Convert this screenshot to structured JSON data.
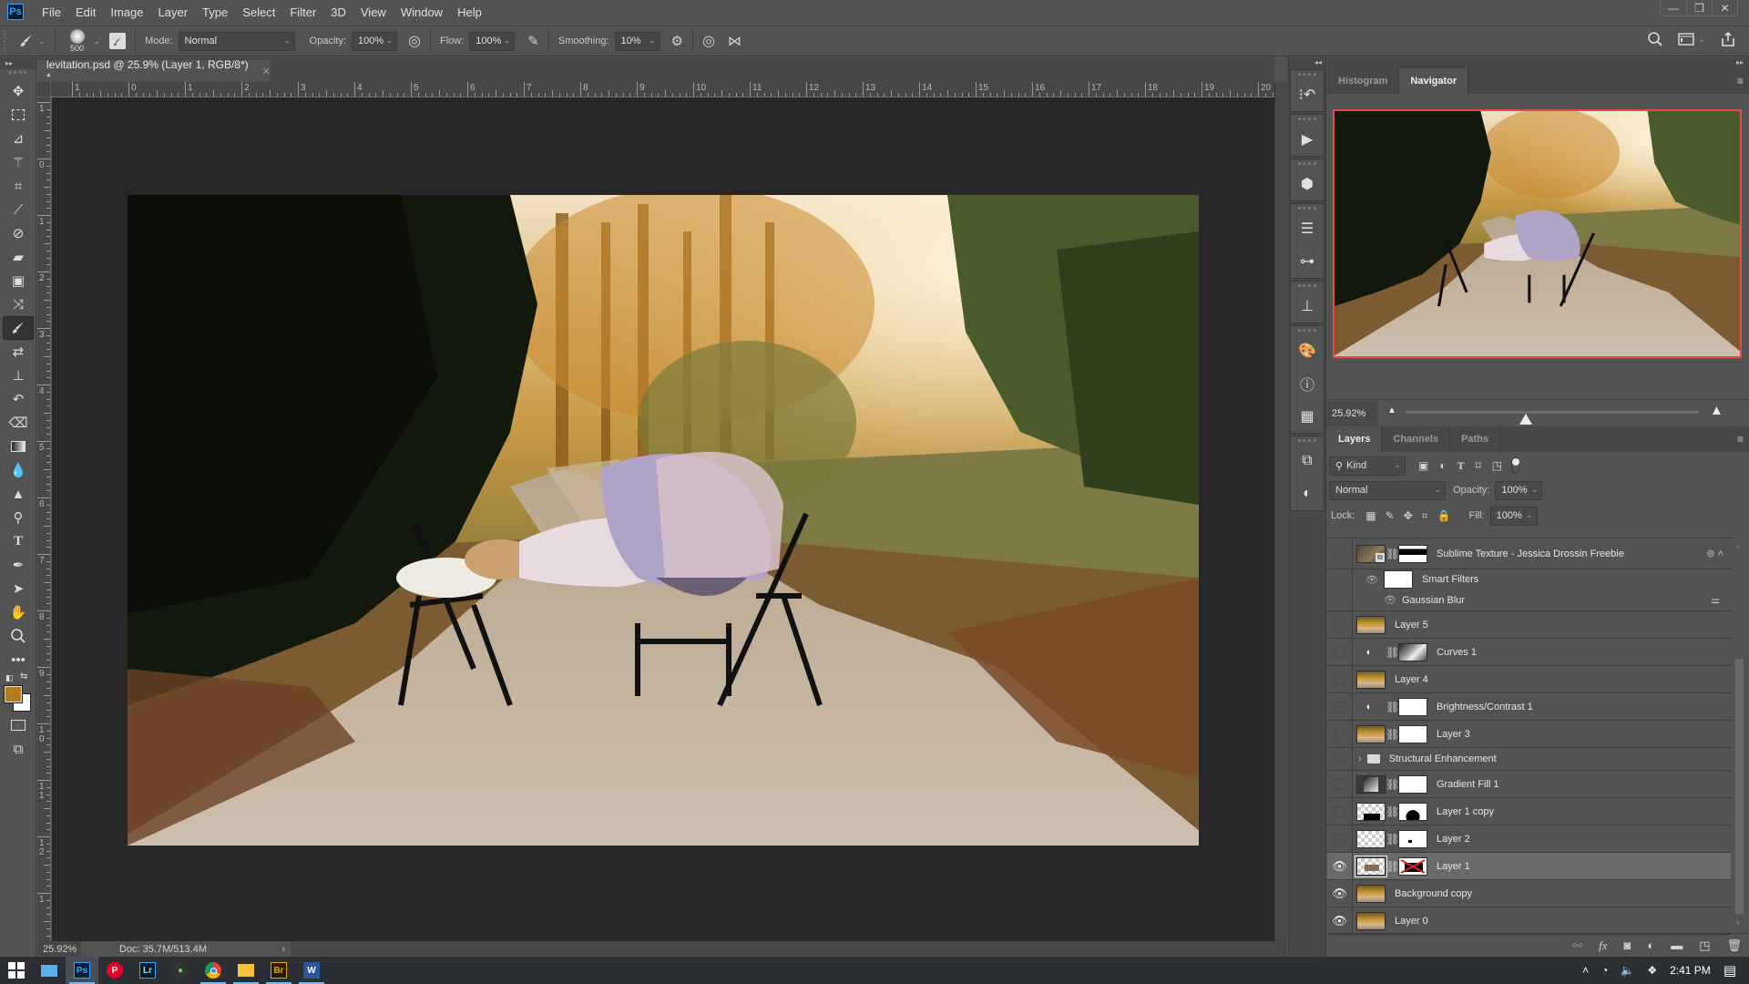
{
  "app": {
    "name": "Adobe Photoshop",
    "logo": "Ps"
  },
  "menu": [
    "File",
    "Edit",
    "Image",
    "Layer",
    "Type",
    "Select",
    "Filter",
    "3D",
    "View",
    "Window",
    "Help"
  ],
  "window_controls": {
    "minimize": "—",
    "restore": "❐",
    "close": "✕"
  },
  "options_bar": {
    "brush_size": "500",
    "mode_label": "Mode:",
    "mode_value": "Normal",
    "opacity_label": "Opacity:",
    "opacity_value": "100%",
    "flow_label": "Flow:",
    "flow_value": "100%",
    "smoothing_label": "Smoothing:",
    "smoothing_value": "10%"
  },
  "document": {
    "tab_title": "levitation.psd @ 25.9% (Layer 1, RGB/8*) *",
    "close": "✕",
    "hruler_labels": [
      "1",
      "0",
      "1",
      "2",
      "3",
      "4",
      "5",
      "6",
      "7",
      "8",
      "9",
      "10",
      "11",
      "12",
      "13",
      "14",
      "15",
      "16",
      "17",
      "18",
      "19",
      "20"
    ],
    "vruler_labels": [
      "1",
      "0",
      "1",
      "2",
      "3",
      "4",
      "5",
      "6",
      "7",
      "8",
      "9",
      "10",
      "11",
      "12",
      "1"
    ]
  },
  "status": {
    "zoom": "25.92%",
    "doc": "Doc: 35.7M/513.4M",
    "arrow": "›"
  },
  "tools": [
    "move",
    "marquee",
    "lasso",
    "magic-wand",
    "crop",
    "eyedropper",
    "spot-healing",
    "healing",
    "patch",
    "content-aware-move",
    "brush",
    "color-replacement",
    "clone-stamp",
    "history-brush",
    "eraser",
    "gradient",
    "blur",
    "sharpen",
    "dodge",
    "type",
    "pen",
    "path-select",
    "hand",
    "zoom",
    "more"
  ],
  "colors": {
    "foreground": "#b07e1e",
    "background": "#ffffff",
    "accent": "#31a8ff",
    "nav_box": "#e84a4a"
  },
  "navigator": {
    "tabs": [
      "Histogram",
      "Navigator"
    ],
    "active_tab": "Navigator",
    "zoom": "25.92%",
    "zoom_slider_fraction": 0.41
  },
  "layers_panel": {
    "tabs": [
      "Layers",
      "Channels",
      "Paths"
    ],
    "active_tab": "Layers",
    "filter_kind": "Kind",
    "blend_mode": "Normal",
    "opacity_label": "Opacity:",
    "opacity": "100%",
    "lock_label": "Lock:",
    "fill_label": "Fill:",
    "fill": "100%",
    "layers": [
      {
        "name": "Sublime Texture - Jessica Drossin Freebie",
        "visible": false,
        "type": "smart",
        "mask": true
      },
      {
        "name": "Smart Filters",
        "visible": true,
        "type": "smart-filters"
      },
      {
        "name": "Gaussian Blur",
        "visible": true,
        "type": "filter"
      },
      {
        "name": "Layer 5",
        "visible": false,
        "type": "pixel"
      },
      {
        "name": "Curves 1",
        "visible": false,
        "type": "adjustment",
        "mask": true
      },
      {
        "name": "Layer 4",
        "visible": false,
        "type": "pixel"
      },
      {
        "name": "Brightness/Contrast 1",
        "visible": false,
        "type": "adjustment",
        "mask": true
      },
      {
        "name": "Layer 3",
        "visible": false,
        "type": "pixel",
        "mask": true
      },
      {
        "name": "Structural Enhancement",
        "visible": false,
        "type": "group"
      },
      {
        "name": "Gradient Fill 1",
        "visible": false,
        "type": "fill",
        "mask": true
      },
      {
        "name": "Layer 1 copy",
        "visible": false,
        "type": "transparent",
        "mask": true
      },
      {
        "name": "Layer 2",
        "visible": false,
        "type": "transparent",
        "mask": true
      },
      {
        "name": "Layer 1",
        "visible": true,
        "type": "transparent",
        "mask": true,
        "selected": true
      },
      {
        "name": "Background copy",
        "visible": true,
        "type": "pixel"
      },
      {
        "name": "Layer 0",
        "visible": true,
        "type": "pixel"
      }
    ]
  },
  "taskbar": {
    "apps": [
      "Start",
      "Desktop",
      "Photoshop",
      "Pinterest",
      "Lightroom",
      "Camera",
      "Chrome",
      "File Explorer",
      "Bridge",
      "Word"
    ],
    "app_labels": {
      "ps": "Ps",
      "lr": "Lr",
      "br": "Br",
      "word": "W"
    },
    "time": "2:41 PM"
  }
}
